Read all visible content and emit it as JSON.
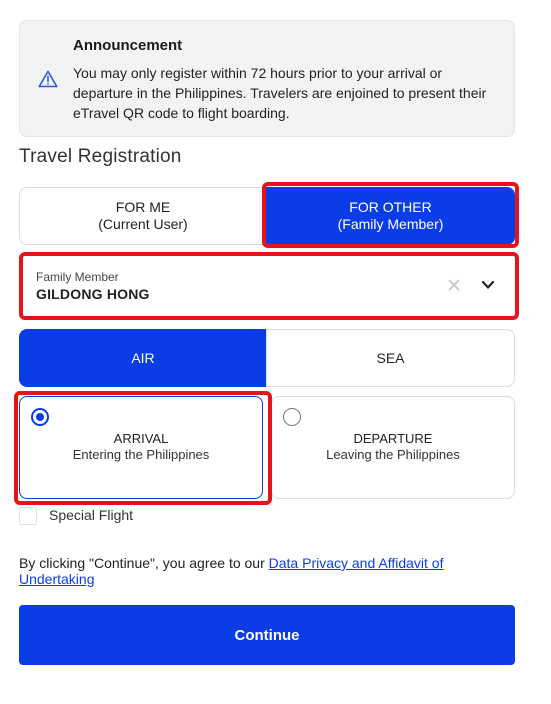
{
  "announcement": {
    "title": "Announcement",
    "text": "You may only register within 72 hours prior to your arrival or departure in the Philippines. Travelers are enjoined to present their eTravel QR code to flight boarding.",
    "icon": "warning-triangle-icon"
  },
  "section_title": "Travel Registration",
  "registrant": {
    "for_me": {
      "label": "FOR ME",
      "sub": "(Current User)"
    },
    "for_other": {
      "label": "FOR OTHER",
      "sub": "(Family Member)",
      "selected": true
    }
  },
  "family_member": {
    "label": "Family Member",
    "value": "GILDONG HONG",
    "clear_icon": "close-icon",
    "dropdown_icon": "chevron-down-icon"
  },
  "mode": {
    "air": "AIR",
    "sea": "SEA",
    "selected": "AIR"
  },
  "direction": {
    "arrival": {
      "title": "ARRIVAL",
      "sub": "Entering the Philippines",
      "selected": true
    },
    "departure": {
      "title": "DEPARTURE",
      "sub": "Leaving the Philippines",
      "selected": false
    }
  },
  "special_flight": {
    "label": "Special Flight",
    "checked": false
  },
  "consent": {
    "prefix": "By clicking \"Continue\", you agree to our ",
    "link_text": "Data Privacy and Affidavit of Undertaking"
  },
  "continue_label": "Continue",
  "colors": {
    "primary": "#0a3de5",
    "highlight": "#e4141b",
    "announcement_bg": "#f2f3f5"
  }
}
